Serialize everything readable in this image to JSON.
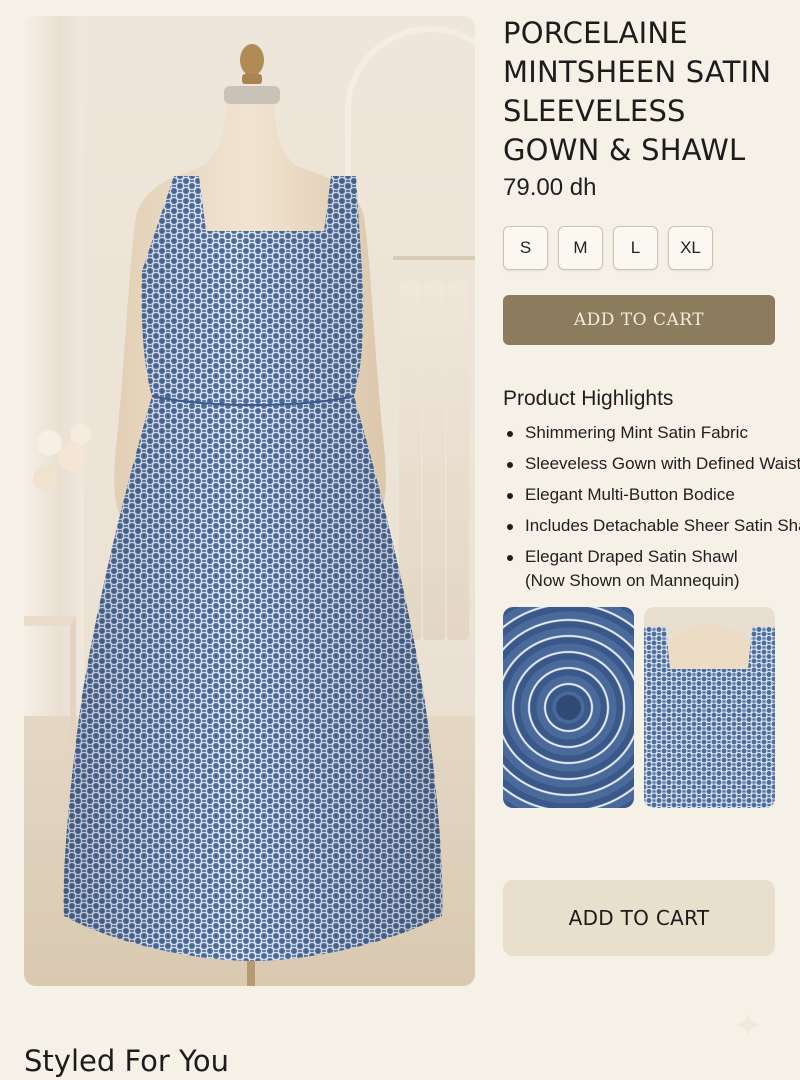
{
  "product": {
    "title": "PORCELAINE\nMINTSHEEN SATIN\nSLEEVELESS\nGOWN & SHAWL",
    "price": "79.00 dh"
  },
  "sizes": [
    "S",
    "M",
    "L",
    "XL"
  ],
  "buttons": {
    "add_to_cart_primary": "ADD TO CART",
    "add_to_cart_secondary": "ADD TO CART"
  },
  "highlights": {
    "title": "Product Highlights",
    "items": [
      "Shimmering Mint Satin Fabric",
      "Sleeveless Gown with Defined Waist",
      "Elegant Multi-Button Bodice",
      "Includes Detachable Sheer Satin Shawl",
      "Elegant Draped Satin Shawl (Now Shown on Mannequin)"
    ]
  },
  "section": {
    "styled_heading": "Styled For You"
  },
  "images": {
    "hero": "dress-on-mannequin",
    "thumbnails": [
      "fabric-swirl",
      "bodice-closeup"
    ]
  },
  "icons": {
    "sparkle": "sparkle-icon"
  },
  "colors": {
    "background": "#f6f1e7",
    "primary_button": "#8b7c5e",
    "secondary_button": "#e9dfcd",
    "dress_blue": "#4a6a9c"
  }
}
